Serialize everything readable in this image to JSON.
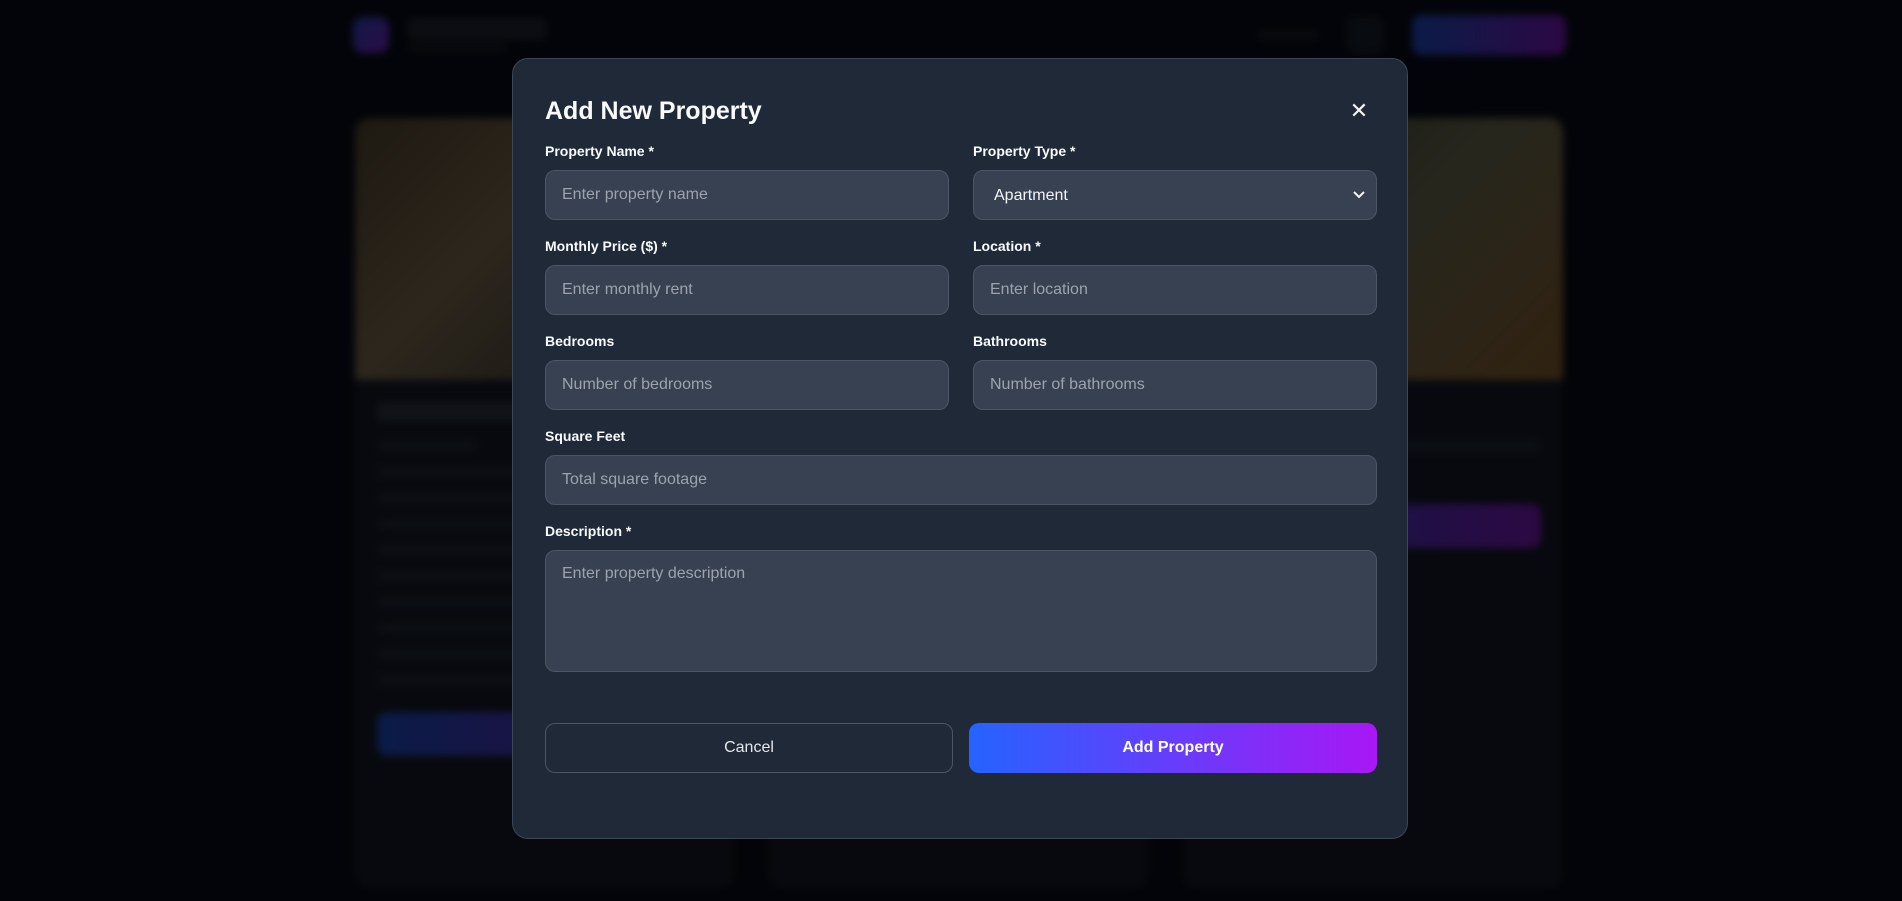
{
  "colors": {
    "page_bg": "#0b1020",
    "modal_bg": "#1f2937",
    "input_bg": "#374151",
    "accent_start": "#2563ff",
    "accent_end": "#a817f5"
  },
  "modal": {
    "title": "Add New Property",
    "close_icon": "close-icon",
    "fields": {
      "property_name": {
        "label": "Property Name *",
        "placeholder": "Enter property name",
        "value": ""
      },
      "property_type": {
        "label": "Property Type *",
        "value": "Apartment",
        "chevron_icon": "chevron-down-icon"
      },
      "monthly_price": {
        "label": "Monthly Price ($) *",
        "placeholder": "Enter monthly rent",
        "value": ""
      },
      "location": {
        "label": "Location *",
        "placeholder": "Enter location",
        "value": ""
      },
      "bedrooms": {
        "label": "Bedrooms",
        "placeholder": "Number of bedrooms",
        "value": ""
      },
      "bathrooms": {
        "label": "Bathrooms",
        "placeholder": "Number of bathrooms",
        "value": ""
      },
      "square_feet": {
        "label": "Square Feet",
        "placeholder": "Total square footage",
        "value": ""
      },
      "description": {
        "label": "Description *",
        "placeholder": "Enter property description",
        "value": ""
      }
    },
    "buttons": {
      "cancel": "Cancel",
      "submit": "Add Property"
    }
  }
}
